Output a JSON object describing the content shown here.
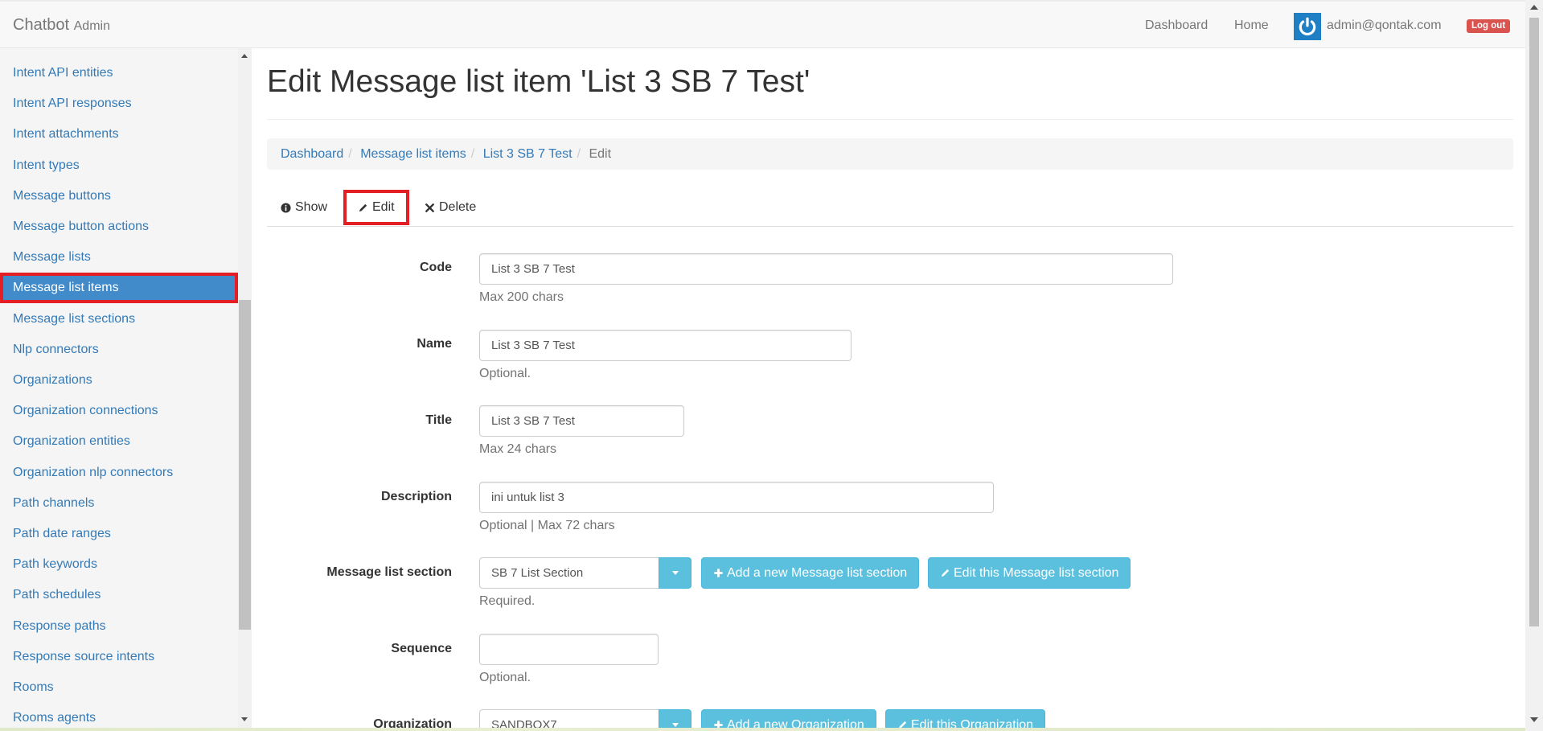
{
  "navbar": {
    "brand": "Chatbot",
    "brand_suffix": "Admin",
    "links": [
      "Dashboard",
      "Home"
    ],
    "user_email": "admin@qontak.com",
    "logout_label": "Log out"
  },
  "sidebar": {
    "items": [
      {
        "label": "Intent API entities",
        "active": false
      },
      {
        "label": "Intent API responses",
        "active": false
      },
      {
        "label": "Intent attachments",
        "active": false
      },
      {
        "label": "Intent types",
        "active": false
      },
      {
        "label": "Message buttons",
        "active": false
      },
      {
        "label": "Message button actions",
        "active": false
      },
      {
        "label": "Message lists",
        "active": false
      },
      {
        "label": "Message list items",
        "active": true
      },
      {
        "label": "Message list sections",
        "active": false
      },
      {
        "label": "Nlp connectors",
        "active": false
      },
      {
        "label": "Organizations",
        "active": false
      },
      {
        "label": "Organization connections",
        "active": false
      },
      {
        "label": "Organization entities",
        "active": false
      },
      {
        "label": "Organization nlp connectors",
        "active": false
      },
      {
        "label": "Path channels",
        "active": false
      },
      {
        "label": "Path date ranges",
        "active": false
      },
      {
        "label": "Path keywords",
        "active": false
      },
      {
        "label": "Path schedules",
        "active": false
      },
      {
        "label": "Response paths",
        "active": false
      },
      {
        "label": "Response source intents",
        "active": false
      },
      {
        "label": "Rooms",
        "active": false
      },
      {
        "label": "Rooms agents",
        "active": false
      }
    ]
  },
  "main": {
    "title": "Edit Message list item 'List 3 SB 7 Test'",
    "breadcrumb": [
      "Dashboard",
      "Message list items",
      "List 3 SB 7 Test",
      "Edit"
    ],
    "tabs": {
      "show": "Show",
      "edit": "Edit",
      "delete": "Delete"
    },
    "form": {
      "code": {
        "label": "Code",
        "value": "List 3 SB 7 Test",
        "help": "Max 200 chars"
      },
      "name": {
        "label": "Name",
        "value": "List 3 SB 7 Test",
        "help": "Optional."
      },
      "title": {
        "label": "Title",
        "value": "List 3 SB 7 Test",
        "help": "Max 24 chars"
      },
      "description": {
        "label": "Description",
        "value": "ini untuk list 3",
        "help": "Optional | Max 72 chars"
      },
      "section": {
        "label": "Message list section",
        "value": "SB 7 List Section",
        "add_label": "Add a new Message list section",
        "edit_label": "Edit this Message list section",
        "help": "Required."
      },
      "sequence": {
        "label": "Sequence",
        "value": "",
        "help": "Optional."
      },
      "organization": {
        "label": "Organization",
        "value": "SANDBOX7",
        "add_label": "Add a new Organization",
        "edit_label": "Edit this Organization"
      }
    }
  },
  "colors": {
    "link": "#337ab7",
    "active_bg": "#428bca",
    "highlight": "#e31e24",
    "info_btn": "#5bc0de",
    "danger": "#d9534f"
  }
}
